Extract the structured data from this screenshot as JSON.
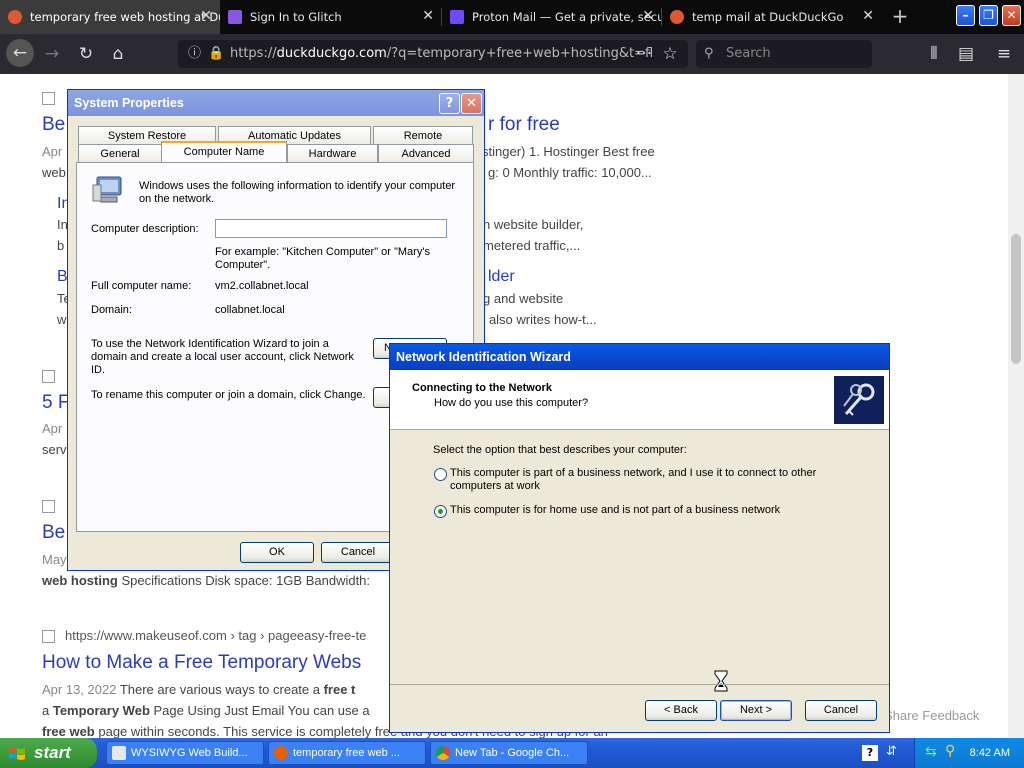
{
  "browser": {
    "tabs": [
      {
        "title": "temporary free web hosting at DuckDuckGo",
        "active": true
      },
      {
        "title": "Sign In to Glitch",
        "active": false
      },
      {
        "title": "Proton Mail — Get a private, secure email",
        "active": false
      },
      {
        "title": "temp mail at DuckDuckGo",
        "active": false
      }
    ],
    "url_prefix": "https://",
    "url_domain": "duckduckgo.com",
    "url_rest": "/?q=temporary+free+web+hosting&t=fl",
    "search_placeholder": "Search"
  },
  "page": {
    "r1_title_a": "Be",
    "r1_title_b": "r for free",
    "r1_snip_a": "Apr",
    "r1_snip_b": "stinger) 1. Hostinger Best free",
    "r1_snip_c": "web",
    "r1_snip_d": "g: 0 Monthly traffic: 10,000...",
    "r1_sub1_a": "In",
    "r1_sub1_b": "n website builder,",
    "r1_sub1_c": "In",
    "r1_sub1_d": "metered traffic,...",
    "r1_sub1_e": "b",
    "r1_sub2_a": "B",
    "r1_sub2_b": "lder",
    "r1_sub2_c": "Te",
    "r1_sub2_d": "g and website",
    "r1_sub2_e": "w",
    "r1_sub2_f": ") also writes how-t...",
    "r2_title": "5 F",
    "r2_snip_a": "Apr",
    "r2_snip_b": "serv",
    "r3_title": "Be",
    "r3_snip_a": "May",
    "r3_snip_b_bold": "web hosting",
    "r3_snip_b_rest": " Specifications Disk space: 1GB Bandwidth:",
    "r4_url": "https://www.makeuseof.com › tag › pageeasy-free-te",
    "r4_title": "How to Make a Free Temporary Webs",
    "r4_date": "Apr 13, 2022",
    "r4_snip_a": " There are various ways to create a ",
    "r4_snip_a_bold": "free t",
    "r4_snip_b_pre": "a ",
    "r4_snip_b_bold": "Temporary Web",
    "r4_snip_b_rest": " Page Using Just Email You can use a",
    "r4_snip_c_bold": "free web",
    "r4_snip_c_rest": " page within seconds. This service is completely free and you don't need to sign up for an",
    "share_feedback": "Share Feedback"
  },
  "sysprops": {
    "title": "System Properties",
    "tabs_row1": [
      "System Restore",
      "Automatic Updates",
      "Remote"
    ],
    "tabs_row2": [
      "General",
      "Computer Name",
      "Hardware",
      "Advanced"
    ],
    "intro": "Windows uses the following information to identify your computer on the network.",
    "desc_label": "Computer description:",
    "desc_value": "",
    "example": "For example: \"Kitchen Computer\" or \"Mary's Computer\".",
    "fullname_label": "Full computer name:",
    "fullname_value": "vm2.collabnet.local",
    "domain_label": "Domain:",
    "domain_value": "collabnet.local",
    "netid_text": "To use the Network Identification Wizard to join a domain and create a local user account, click Network ID.",
    "netid_button": "N",
    "rename_text": "To rename this computer or join a domain, click Change.",
    "ok": "OK",
    "cancel": "Cancel"
  },
  "wizard": {
    "title": "Network Identification Wizard",
    "heading": "Connecting to the Network",
    "subheading": "How do you use this computer?",
    "prompt": "Select the option that best describes your computer:",
    "option1": "This computer is part of a business network, and I use it to connect to other computers at work",
    "option2": "This computer is for home use and is not part of a business network",
    "selected": 2,
    "back": "< Back",
    "next": "Next >",
    "cancel": "Cancel"
  },
  "taskbar": {
    "start": "start",
    "items": [
      "WYSIWYG Web Build...",
      "temporary free web ...",
      "New Tab - Google Ch..."
    ],
    "clock": "8:42 AM"
  },
  "colors": {
    "xp_blue": "#0a5ae6",
    "link": "#2b3cb6",
    "start_green": "#3a9a3a"
  }
}
